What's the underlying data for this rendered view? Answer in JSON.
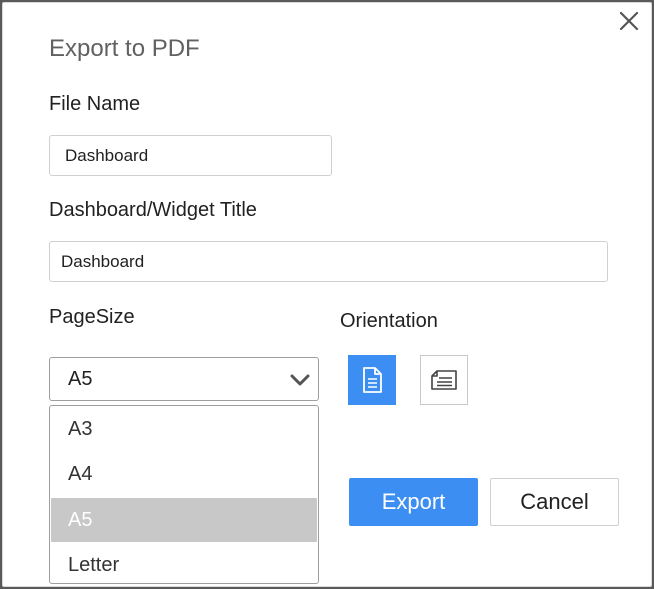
{
  "dialog": {
    "title": "Export to PDF",
    "close_icon": "close-icon"
  },
  "file_name": {
    "label": "File Name",
    "value": "Dashboard"
  },
  "widget_title": {
    "label": "Dashboard/Widget Title",
    "value": "Dashboard"
  },
  "page_size": {
    "label": "PageSize",
    "selected": "A5",
    "options": [
      "A3",
      "A4",
      "A5",
      "Letter"
    ]
  },
  "orientation": {
    "label": "Orientation",
    "options": [
      {
        "name": "portrait",
        "icon": "portrait-page-icon",
        "active": true
      },
      {
        "name": "landscape",
        "icon": "landscape-page-icon",
        "active": false
      }
    ]
  },
  "buttons": {
    "export": "Export",
    "cancel": "Cancel"
  },
  "colors": {
    "accent": "#3c8ef3",
    "selected_option_bg": "#c8c8c8"
  }
}
